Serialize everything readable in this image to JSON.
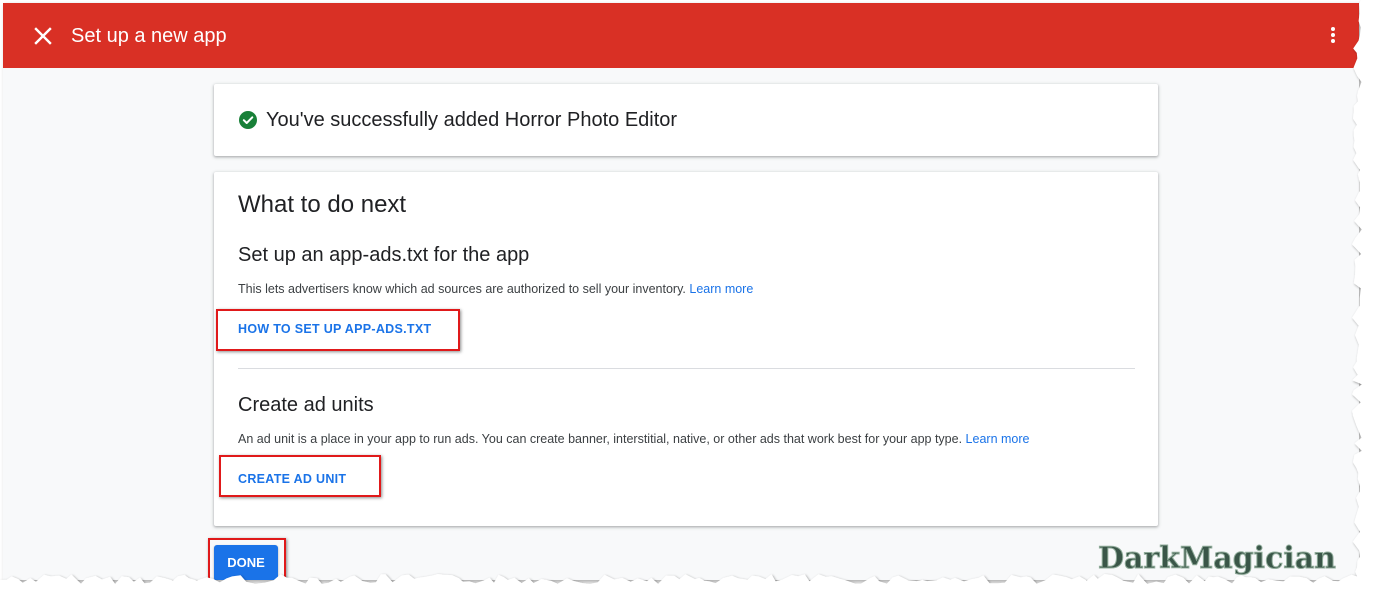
{
  "header": {
    "title": "Set up a new app",
    "close_icon": "close-icon",
    "menu_icon": "more-vert-icon",
    "color": "#d93025"
  },
  "success_card": {
    "icon": "check-circle-icon",
    "icon_color": "#188038",
    "message": "You've successfully added Horror Photo Editor"
  },
  "next_card": {
    "heading": "What to do next",
    "app_ads": {
      "title": "Set up an app-ads.txt for the app",
      "description": "This lets advertisers know which ad sources are authorized to sell your inventory.",
      "learn_more": "Learn more",
      "button": "HOW TO SET UP APP-ADS.TXT"
    },
    "ad_units": {
      "title": "Create ad units",
      "description": "An ad unit is a place in your app to run ads. You can create banner, interstitial, native, or other ads that work best for your app type.",
      "learn_more": "Learn more",
      "button": "CREATE AD UNIT"
    }
  },
  "footer": {
    "done_button": "DONE"
  },
  "watermark": {
    "text": "DarkMagician"
  },
  "colors": {
    "accent": "#1a73e8",
    "highlight": "#e0191a"
  }
}
